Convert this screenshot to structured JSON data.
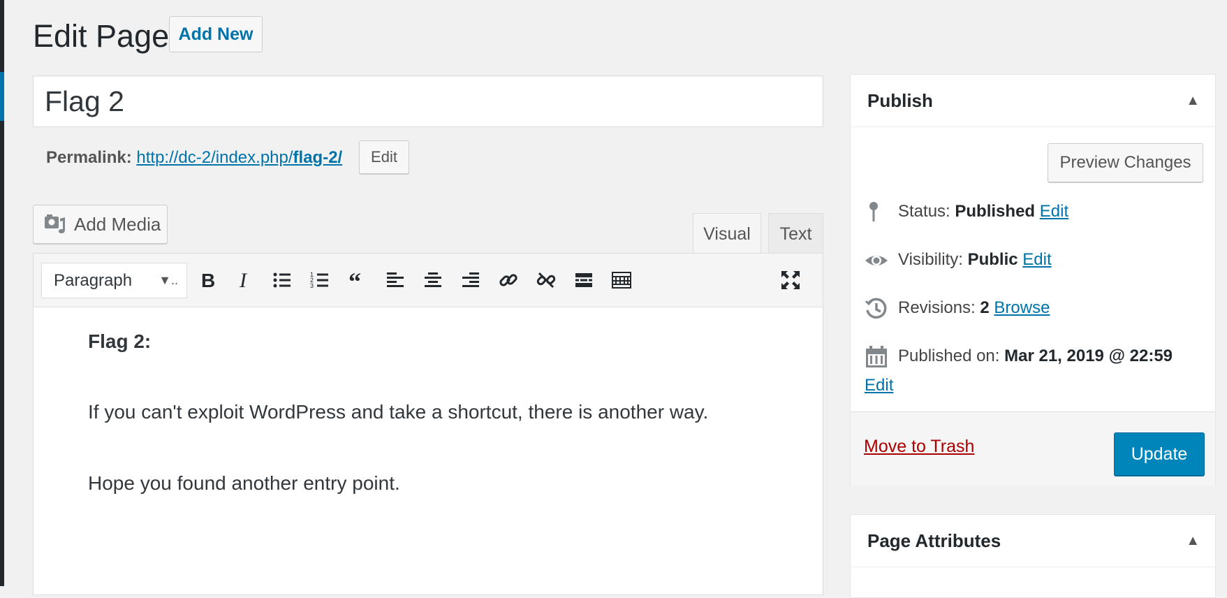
{
  "header": {
    "title": "Edit Page",
    "add_new_label": "Add New"
  },
  "post": {
    "title_value": "Flag 2",
    "permalink_label": "Permalink:",
    "permalink_base": "http://dc-2/index.php/",
    "permalink_slug": "flag-2/",
    "permalink_edit_label": "Edit"
  },
  "editor": {
    "add_media_label": "Add Media",
    "tabs": [
      {
        "label": "Visual",
        "active": true
      },
      {
        "label": "Text",
        "active": false
      }
    ],
    "format_select": "Paragraph",
    "toolbar_icons": [
      "bold-icon",
      "italic-icon",
      "bulleted-list-icon",
      "numbered-list-icon",
      "blockquote-icon",
      "align-left-icon",
      "align-center-icon",
      "align-right-icon",
      "insert-link-icon",
      "remove-link-icon",
      "read-more-icon",
      "toolbar-toggle-icon",
      "fullscreen-icon"
    ],
    "content": {
      "heading": "Flag 2:",
      "paragraph_1": "If you can't exploit WordPress and take a shortcut, there is another way.",
      "paragraph_2": "Hope you found another entry point."
    }
  },
  "publish": {
    "title": "Publish",
    "preview_label": "Preview Changes",
    "status_label": "Status:",
    "status_value": "Published",
    "visibility_label": "Visibility:",
    "visibility_value": "Public",
    "revisions_label": "Revisions:",
    "revisions_value": "2",
    "browse_label": "Browse",
    "published_on_label": "Published on:",
    "published_on_value": "Mar 21, 2019 @ 22:59",
    "edit_label": "Edit",
    "trash_label": "Move to Trash",
    "update_label": "Update"
  },
  "page_attributes": {
    "title": "Page Attributes"
  },
  "colors": {
    "accent": "#0073aa",
    "primary_button": "#0085ba",
    "trash": "#a00000",
    "background": "#f1f1f1"
  }
}
